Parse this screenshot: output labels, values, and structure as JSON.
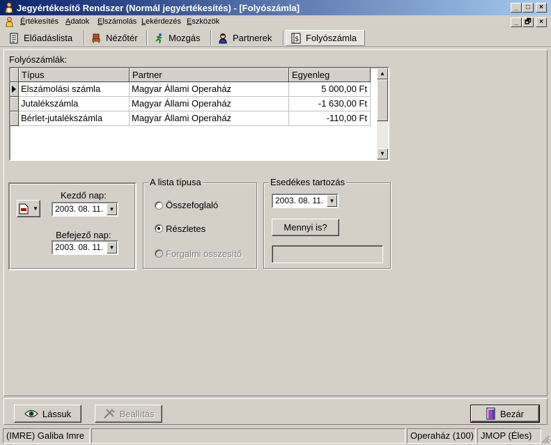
{
  "window": {
    "title": "Jegyértékesítő Rendszer (Normál jegyértékesítés) - [Folyószámla]",
    "caption_buttons": [
      "_",
      "□",
      "×"
    ],
    "mdi_buttons": [
      "_",
      "🗗",
      "×"
    ]
  },
  "menu": {
    "items": [
      {
        "label": "Értékesítés",
        "accel": "É",
        "rest": "rtékesítés"
      },
      {
        "label": "Adatok",
        "accel": "A",
        "rest": "datok"
      },
      {
        "label": "Elszámolás",
        "accel": "E",
        "rest": "lszámolás"
      },
      {
        "label": "Lekérdezés",
        "accel": "L",
        "rest": "ekérdezés"
      },
      {
        "label": "Eszközök",
        "accel": "E",
        "rest": "szközök"
      }
    ]
  },
  "tabs": [
    {
      "label": "Előadáslista",
      "icon": "document-list-icon"
    },
    {
      "label": "Nézőtér",
      "icon": "seat-icon"
    },
    {
      "label": "Mozgás",
      "icon": "running-person-icon"
    },
    {
      "label": "Partnerek",
      "icon": "person-icon"
    },
    {
      "label": "Folyószámla",
      "icon": "ledger-icon",
      "active": true
    }
  ],
  "accounts": {
    "title": "Folyószámlák:",
    "columns": [
      "Típus",
      "Partner",
      "Egyenleg"
    ],
    "rows": [
      {
        "type": "Elszámolási számla",
        "partner": "Magyar Állami Operaház",
        "balance": "5 000,00 Ft"
      },
      {
        "type": "Jutalékszámla",
        "partner": "Magyar Állami Operaház",
        "balance": "-1 630,00 Ft"
      },
      {
        "type": "Bérlet-jutalékszámla",
        "partner": "Magyar Állami Operaház",
        "balance": "-110,00 Ft"
      }
    ]
  },
  "date_range": {
    "start_label": "Kezdő nap:",
    "start_value": "2003. 08. 11.",
    "end_label": "Befejező nap:",
    "end_value": "2003. 08. 11."
  },
  "list_type": {
    "title": "A lista típusa",
    "options": [
      {
        "label": "Összefoglaló",
        "checked": false,
        "enabled": true
      },
      {
        "label": "Részletes",
        "checked": true,
        "enabled": true
      },
      {
        "label": "Forgalmi összesítő",
        "checked": false,
        "enabled": false
      }
    ]
  },
  "due": {
    "title": "Esedékes tartozás",
    "date_value": "2003. 08. 11.",
    "button_label": "Mennyi is?",
    "result": ""
  },
  "footer": {
    "view_button": "Lássuk",
    "settings_button": "Beállítás",
    "close_button": "Bezár"
  },
  "status": {
    "user": "(IMRE) Galiba Imre",
    "middle": "",
    "venue": "Operaház (100)",
    "mode": "JMOP (Éles)"
  }
}
